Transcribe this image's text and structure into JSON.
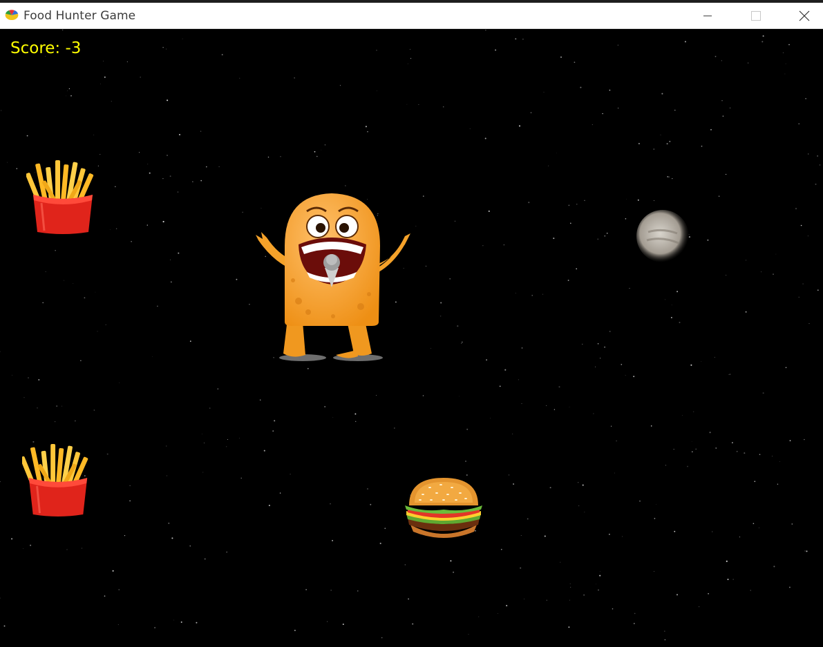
{
  "window": {
    "title": "Food Hunter Game",
    "controls": {
      "minimize": "minimize",
      "maximize": "maximize",
      "close": "close"
    }
  },
  "hud": {
    "score_text": "Score: -3",
    "score_color": "#ffff00"
  },
  "sprites": [
    {
      "name": "french-fries",
      "count": 2
    },
    {
      "name": "monster-player"
    },
    {
      "name": "moon-rock"
    },
    {
      "name": "hamburger"
    }
  ],
  "colors": {
    "background": "#000000",
    "titlebar": "#ffffff",
    "monster": "#f5a22a",
    "fries_box": "#e0241b",
    "fries": "#ffc73a"
  }
}
